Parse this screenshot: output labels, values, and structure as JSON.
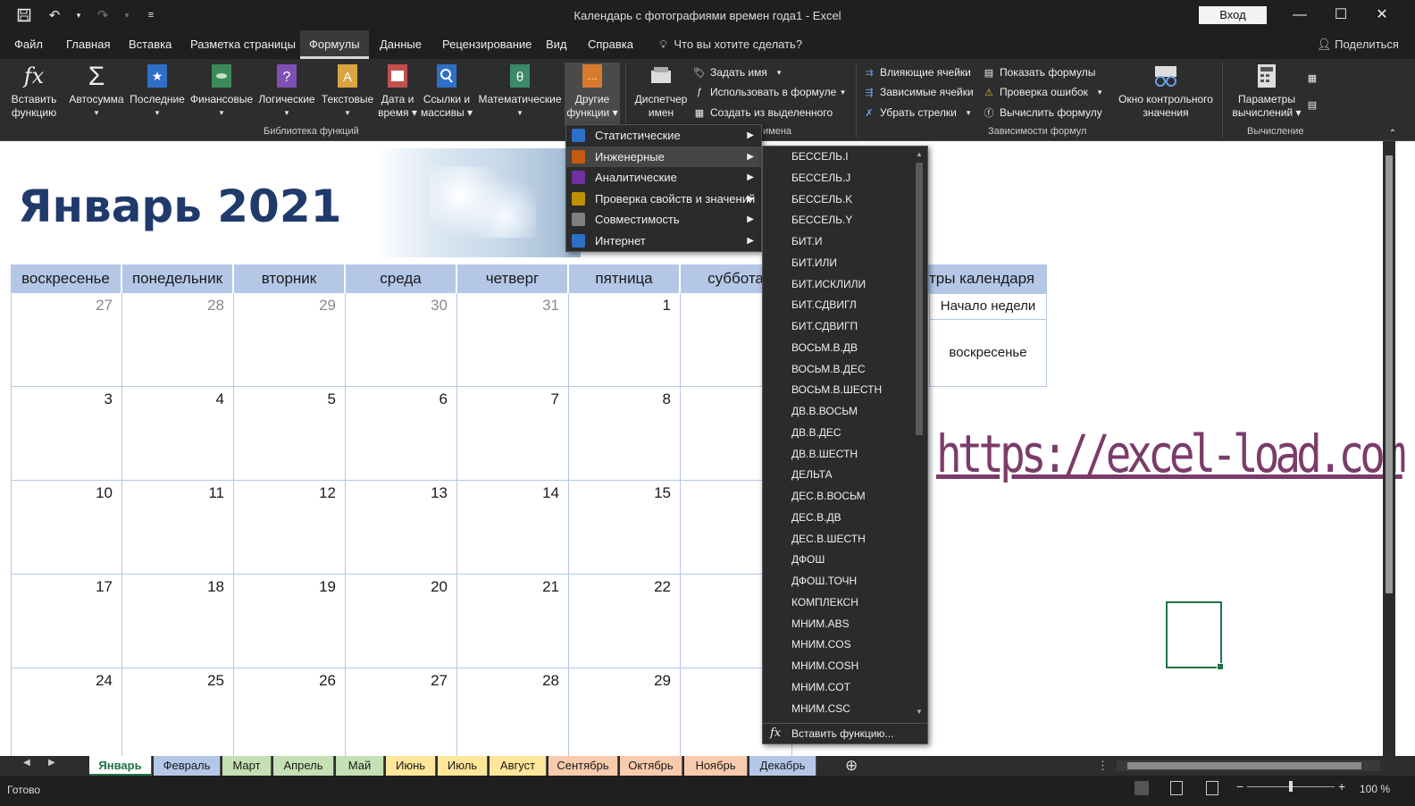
{
  "window": {
    "title": "Календарь с фотографиями времен года1  -  Excel",
    "signin_label": "Вход",
    "controls": [
      "restore-down",
      "minimize",
      "maximize",
      "close"
    ]
  },
  "menu": {
    "tabs": [
      "Файл",
      "Главная",
      "Вставка",
      "Разметка страницы",
      "Формулы",
      "Данные",
      "Рецензирование",
      "Вид",
      "Справка"
    ],
    "active": "Формулы",
    "tell_me": "Что вы хотите сделать?",
    "share": "Поделиться"
  },
  "ribbon": {
    "insert_function": [
      "Вставить",
      "функцию"
    ],
    "autosum": [
      "Автосумма",
      "▾"
    ],
    "recent": [
      "Последние",
      "▾"
    ],
    "financial": [
      "Финансовые",
      "▾"
    ],
    "logical": [
      "Логические",
      "▾"
    ],
    "text": [
      "Текстовые",
      "▾"
    ],
    "datetime": [
      "Дата и",
      "время ▾"
    ],
    "lookup": [
      "Ссылки и",
      "массивы ▾"
    ],
    "math": [
      "Математические",
      "▾"
    ],
    "other": [
      "Другие",
      "функции ▾"
    ],
    "name_manager": [
      "Диспетчер",
      "имен"
    ],
    "define_name": "Задать имя",
    "use_in_formula": "Использовать в формуле",
    "create_from_selection": "Создать из выделенного",
    "trace_precedents": "Влияющие ячейки",
    "trace_dependents": "Зависимые ячейки",
    "remove_arrows": "Убрать стрелки",
    "show_formulas": "Показать формулы",
    "error_checking": "Проверка ошибок",
    "evaluate_formula": "Вычислить формулу",
    "watch_window": [
      "Окно контрольного",
      "значения"
    ],
    "calc_options": [
      "Параметры",
      "вычислений ▾"
    ],
    "group_library": "Библиотека функций",
    "group_names": "имена",
    "group_audit": "Зависимости формул",
    "group_calc": "Вычисление"
  },
  "sheet": {
    "month_title": "Январь 2021",
    "weekdays": [
      "воскресенье",
      "понедельник",
      "вторник",
      "среда",
      "четверг",
      "пятница",
      "суббота"
    ],
    "weeks": [
      [
        "27",
        "28",
        "29",
        "30",
        "31",
        "1",
        ""
      ],
      [
        "3",
        "4",
        "5",
        "6",
        "7",
        "8",
        ""
      ],
      [
        "10",
        "11",
        "12",
        "13",
        "14",
        "15",
        ""
      ],
      [
        "17",
        "18",
        "19",
        "20",
        "21",
        "22",
        ""
      ],
      [
        "24",
        "25",
        "26",
        "27",
        "28",
        "29",
        ""
      ]
    ],
    "settings_header": "тры календаря",
    "week_start_label": "Начало недели",
    "week_start_value": "воскресенье",
    "link_text": "https://excel-load.com"
  },
  "dropdown": {
    "items": [
      {
        "label": "Статистические",
        "color": "#2e6fc7"
      },
      {
        "label": "Инженерные",
        "color": "#c55a11"
      },
      {
        "label": "Аналитические",
        "color": "#7030a0"
      },
      {
        "label": "Проверка свойств и значений",
        "color": "#bf9000"
      },
      {
        "label": "Совместимость",
        "color": "#7f7f7f"
      },
      {
        "label": "Интернет",
        "color": "#2e6fc7"
      }
    ],
    "hover_index": 1
  },
  "submenu": {
    "items": [
      "БЕССЕЛЬ.I",
      "БЕССЕЛЬ.J",
      "БЕССЕЛЬ.K",
      "БЕССЕЛЬ.Y",
      "БИТ.И",
      "БИТ.ИЛИ",
      "БИТ.ИСКЛИЛИ",
      "БИТ.СДВИГЛ",
      "БИТ.СДВИГП",
      "ВОСЬМ.В.ДВ",
      "ВОСЬМ.В.ДЕС",
      "ВОСЬМ.В.ШЕСТН",
      "ДВ.В.ВОСЬМ",
      "ДВ.В.ДЕС",
      "ДВ.В.ШЕСТН",
      "ДЕЛЬТА",
      "ДЕС.В.ВОСЬМ",
      "ДЕС.В.ДВ",
      "ДЕС.В.ШЕСТН",
      "ДФОШ",
      "ДФОШ.ТОЧН",
      "КОМПЛЕКСН",
      "МНИМ.ABS",
      "МНИМ.COS",
      "МНИМ.COSH",
      "МНИМ.COT",
      "МНИМ.CSC"
    ],
    "insert_label": "Вставить функцию..."
  },
  "sheet_tabs": [
    {
      "label": "Январь",
      "color": "#ffffff"
    },
    {
      "label": "Февраль",
      "color": "#b4c7e7"
    },
    {
      "label": "Март",
      "color": "#c5e0b4"
    },
    {
      "label": "Апрель",
      "color": "#c5e0b4"
    },
    {
      "label": "Май",
      "color": "#c5e0b4"
    },
    {
      "label": "Июнь",
      "color": "#ffe699"
    },
    {
      "label": "Июль",
      "color": "#ffe699"
    },
    {
      "label": "Август",
      "color": "#ffe699"
    },
    {
      "label": "Сентябрь",
      "color": "#f8cbad"
    },
    {
      "label": "Октябрь",
      "color": "#f8cbad"
    },
    {
      "label": "Ноябрь",
      "color": "#f8cbad"
    },
    {
      "label": "Декабрь",
      "color": "#b4c7e7"
    }
  ],
  "status": {
    "ready": "Готово",
    "zoom": "100 %"
  }
}
